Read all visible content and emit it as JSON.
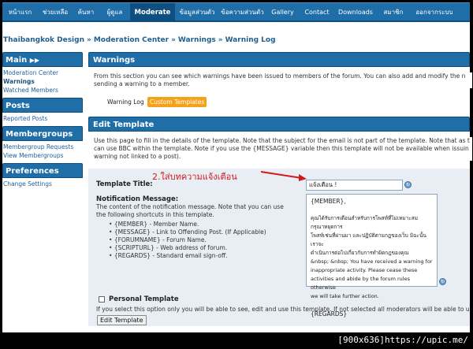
{
  "topnav": {
    "items": [
      {
        "label": "หน้าแรก"
      },
      {
        "label": "ช่วยเหลือ"
      },
      {
        "label": "ค้นหา"
      },
      {
        "label": "ผู้ดูแล"
      },
      {
        "label": "Moderate"
      },
      {
        "label": "ข้อมูลส่วนตัว"
      },
      {
        "label": "ข้อความส่วนตัว"
      },
      {
        "label": "Gallery"
      },
      {
        "label": "Contact"
      },
      {
        "label": "Downloads"
      },
      {
        "label": "สมาชิก"
      },
      {
        "label": "ออกจากระบบ"
      }
    ]
  },
  "breadcrumb": {
    "items": [
      "Thaibangkok Design",
      "Moderation Center",
      "Warnings",
      "Warning Log"
    ],
    "separator": "»"
  },
  "sidebar": {
    "main": {
      "title": "Main",
      "links": [
        "Moderation Center",
        "Warnings",
        "Watched Members"
      ]
    },
    "posts": {
      "title": "Posts",
      "links": [
        "Reported Posts"
      ]
    },
    "membergroups": {
      "title": "Membergroups",
      "links": [
        "Membergroup Requests",
        "View Membergroups"
      ]
    },
    "preferences": {
      "title": "Preferences",
      "links": [
        "Change Settings"
      ]
    }
  },
  "warnings": {
    "title": "Warnings",
    "desc1": "From this section you can see which warnings have been issued to members of the forum. You can also add and modify the n",
    "desc2": "sending a warning to a member.",
    "tabs": [
      "Warning Log",
      "Custom Templates"
    ]
  },
  "edit": {
    "title": "Edit Template",
    "desc1": "Use this page to fill in the details of the template. Note that the subject for the email is not part of the template. Note that as t",
    "desc2": "can use BBC within the template. Note if you use the {MESSAGE} variable then this template will not be available when issuin",
    "desc3": "warning not linked to a post)."
  },
  "form": {
    "title_label": "Template Title:",
    "title_value": "แจ้งเตือน !",
    "notif_label": "Notification Message:",
    "notif_desc1": "The content of the notification message. Note that you can use",
    "notif_desc2": "the following shortcuts in this template.",
    "shortcuts": [
      "{MEMBER} - Member Name.",
      "{MESSAGE} - Link to Offending Post. (If Applicable)",
      "{FORUMNAME} - Forum Name.",
      "{SCRIPTURL} - Web address of forum.",
      "{REGARDS} - Standard email sign-off."
    ],
    "message_lines": [
      "{MEMBER},",
      "",
      "คุณได้รับการเตือนสำหรับการโพสท์ที่ไม่เหมาะสม กรุณาหยุดการ",
      "โพสท์เช่นที่ผ่านมา และปฏิบัติตามกฎของเว็บ มิฉะนั้นเราจะ",
      "ดำเนินการต่อไปเกี่ยวกับการทำผิดกฎของคุณ",
      "&nbsp; &nbsp;  You have received a warning for",
      "inappropriate activity. Please cease these",
      "activities and abide by the forum rules otherwise",
      "we will take further action.",
      "",
      "{REGARDS}"
    ],
    "personal_label": "Personal Template",
    "personal_desc": "If you select this option only you will be able to see, edit and use this template. If not selected all moderators will be able to u",
    "button_label": "Edit Template"
  },
  "annotation": {
    "text": "2.ใส่บทความแจ้งเตือน",
    "color": "#d11b1b"
  },
  "footer": {
    "text": "[900x636]https://upic.me/"
  },
  "colors": {
    "nav": "#1f6ea8",
    "accent_tab": "#f6a11a"
  }
}
